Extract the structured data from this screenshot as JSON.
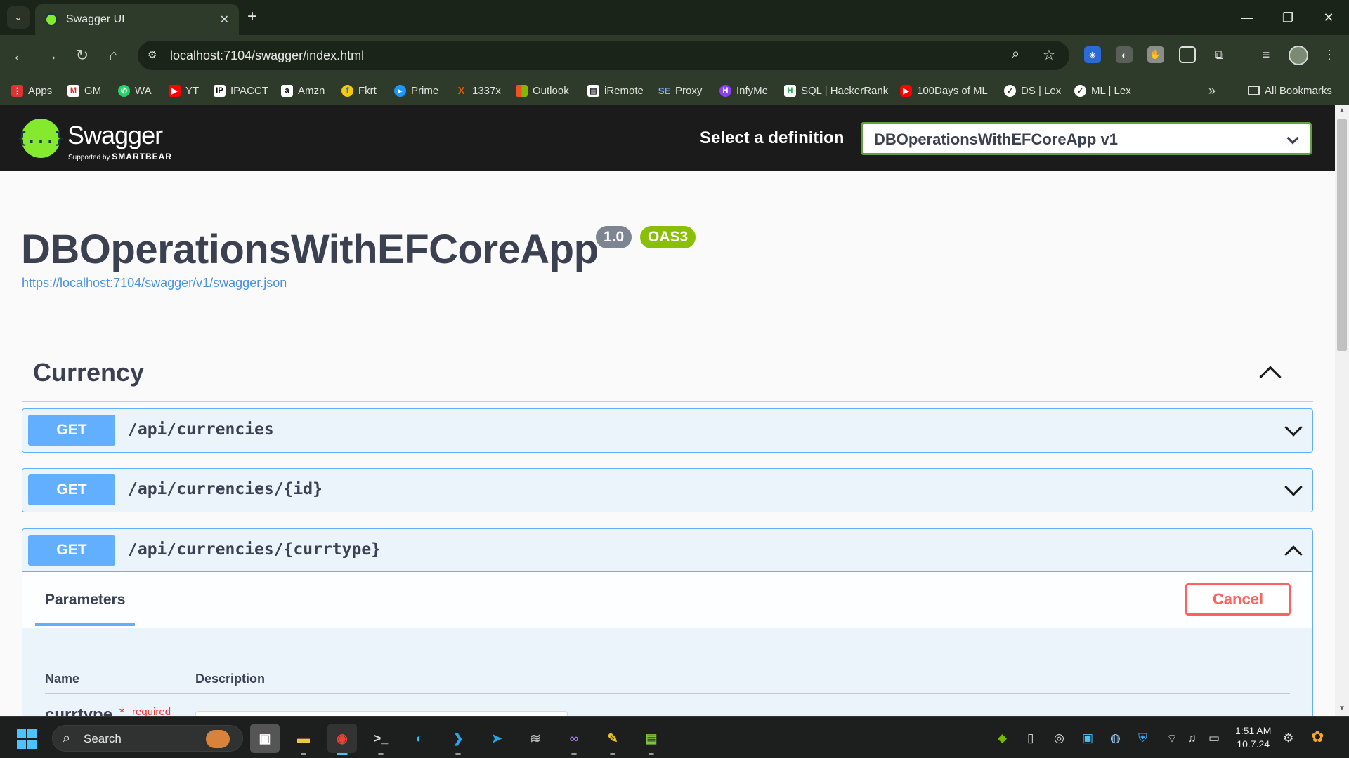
{
  "browser": {
    "tab_title": "Swagger UI",
    "url": "localhost:7104/swagger/index.html",
    "bookmarks": [
      "Apps",
      "GM",
      "WA",
      "YT",
      "IPACCT",
      "Amzn",
      "Fkrt",
      "Prime",
      "1337x",
      "Outlook",
      "iRemote",
      "Proxy",
      "InfyMe",
      "SQL | HackerRank",
      "100Days of ML",
      "DS | Lex",
      "ML | Lex"
    ],
    "all_bookmarks": "All Bookmarks",
    "overflow": "»",
    "new_tab": "+",
    "tab_close": "✕",
    "win_minimize": "—",
    "win_restore": "❐",
    "win_close": "✕"
  },
  "swagger": {
    "brand": "Swagger",
    "supported_by": "Supported by",
    "smartbear": "SMARTBEAR",
    "logo_glyph": "{...}",
    "select_label": "Select a definition",
    "selected_definition": "DBOperationsWithEFCoreApp v1"
  },
  "info": {
    "title": "DBOperationsWithEFCoreApp",
    "version": "1.0",
    "oas": "OAS3",
    "spec_url": "https://localhost:7104/swagger/v1/swagger.json"
  },
  "tag": {
    "name": "Currency"
  },
  "operations": [
    {
      "method": "GET",
      "path": "/api/currencies"
    },
    {
      "method": "GET",
      "path": "/api/currencies/{id}"
    },
    {
      "method": "GET",
      "path": "/api/currencies/{currtype}"
    }
  ],
  "expanded_op": {
    "params_tab": "Parameters",
    "cancel": "Cancel",
    "col_name": "Name",
    "col_desc": "Description",
    "param_name": "currtype",
    "required_star": "*",
    "required": "required"
  },
  "taskbar": {
    "search": "Search",
    "time": "1:51 AM",
    "date": "10.7.24"
  },
  "colors": {
    "get_blue": "#61affe",
    "swagger_green": "#85ea2d",
    "cancel_red": "#ff6060",
    "oas_green": "#89bf04"
  }
}
